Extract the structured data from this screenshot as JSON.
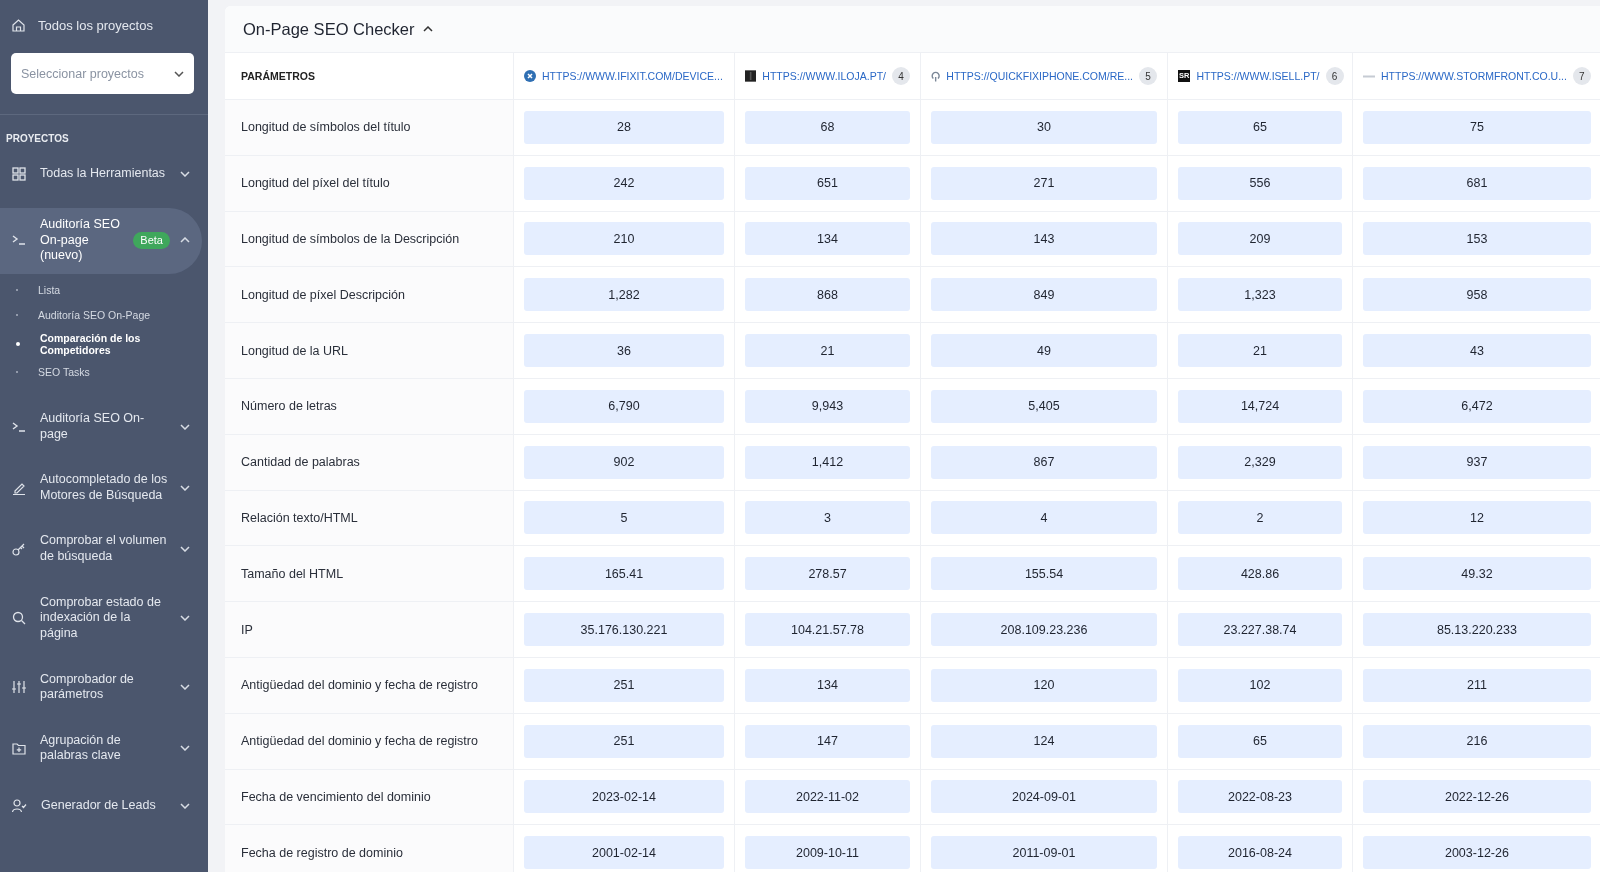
{
  "sidebar": {
    "home_link": "Todos los proyectos",
    "project_select": {
      "placeholder": "Seleccionar proyectos"
    },
    "section_title": "PROYECTOS",
    "items": [
      {
        "kind": "grid",
        "label": "Todas la Herramientas",
        "expanded": false,
        "selected": false
      },
      {
        "kind": "terminal",
        "label": "Auditoría SEO On-page (nuevo)",
        "badge": "Beta",
        "expanded": true,
        "selected": true,
        "children": [
          {
            "label": "Lista",
            "selected": false
          },
          {
            "label": "Auditoría SEO On-Page",
            "selected": false
          },
          {
            "label": "Comparación de los Competidores",
            "selected": true
          },
          {
            "label": "SEO Tasks",
            "selected": false
          }
        ]
      },
      {
        "kind": "terminal",
        "label": "Auditoría SEO On-page",
        "expanded": false,
        "selected": false
      },
      {
        "kind": "pencil",
        "label": "Autocompletado de los Motores de Búsqueda",
        "expanded": false,
        "selected": false
      },
      {
        "kind": "key",
        "label": "Comprobar el volumen de búsqueda",
        "expanded": false,
        "selected": false
      },
      {
        "kind": "search",
        "label": "Comprobar estado de indexación de la página",
        "expanded": false,
        "selected": false
      },
      {
        "kind": "sliders",
        "label": "Comprobador de parámetros",
        "expanded": false,
        "selected": false
      },
      {
        "kind": "folder",
        "label": "Agrupación de palabras clave",
        "expanded": false,
        "selected": false
      },
      {
        "kind": "user",
        "label": "Generador de Leads",
        "expanded": false,
        "selected": false
      }
    ]
  },
  "panel": {
    "title": "On-Page SEO Checker",
    "expanded": true
  },
  "table": {
    "param_header": "PARÁMETROS",
    "columns": [
      {
        "kind": "x-circle",
        "url": "HTTPS://WWW.IFIXIT.COM/DEVICE..."
      },
      {
        "kind": "dark-square",
        "url": "HTTPS://WWW.ILOJA.PT/",
        "count": "4"
      },
      {
        "kind": "ring",
        "url": "HTTPS://QUICKFIXIPHONE.COM/RE...",
        "count": "5"
      },
      {
        "kind": "text",
        "favicon_text": "SR",
        "url": "HTTPS://WWW.ISELL.PT/",
        "count": "6"
      },
      {
        "kind": "dash",
        "url": "HTTPS://WWW.STORMFRONT.CO.U...",
        "count": "7"
      }
    ],
    "rows": [
      {
        "param": "Longitud de símbolos del título",
        "values": [
          "28",
          "68",
          "30",
          "65",
          "75"
        ]
      },
      {
        "param": "Longitud del píxel del título",
        "values": [
          "242",
          "651",
          "271",
          "556",
          "681"
        ]
      },
      {
        "param": "Longitud de símbolos de la Descripción",
        "values": [
          "210",
          "134",
          "143",
          "209",
          "153"
        ]
      },
      {
        "param": "Longitud de píxel Descripción",
        "values": [
          "1,282",
          "868",
          "849",
          "1,323",
          "958"
        ]
      },
      {
        "param": "Longitud de la URL",
        "values": [
          "36",
          "21",
          "49",
          "21",
          "43"
        ]
      },
      {
        "param": "Número de letras",
        "values": [
          "6,790",
          "9,943",
          "5,405",
          "14,724",
          "6,472"
        ]
      },
      {
        "param": "Cantidad de palabras",
        "values": [
          "902",
          "1,412",
          "867",
          "2,329",
          "937"
        ]
      },
      {
        "param": "Relación texto/HTML",
        "values": [
          "5",
          "3",
          "4",
          "2",
          "12"
        ]
      },
      {
        "param": "Tamaño del HTML",
        "values": [
          "165.41",
          "278.57",
          "155.54",
          "428.86",
          "49.32"
        ]
      },
      {
        "param": "IP",
        "values": [
          "35.176.130.221",
          "104.21.57.78",
          "208.109.23.236",
          "23.227.38.74",
          "85.13.220.233"
        ]
      },
      {
        "param": "Antigüedad del dominio y fecha de registro",
        "values": [
          "251",
          "134",
          "120",
          "102",
          "211"
        ]
      },
      {
        "param": "Antigüedad del dominio y fecha de registro",
        "values": [
          "251",
          "147",
          "124",
          "65",
          "216"
        ]
      },
      {
        "param": "Fecha de vencimiento del dominio",
        "values": [
          "2023-02-14",
          "2022-11-02",
          "2024-09-01",
          "2022-08-23",
          "2022-12-26"
        ]
      },
      {
        "param": "Fecha de registro de dominio",
        "values": [
          "2001-02-14",
          "2009-10-11",
          "2011-09-01",
          "2016-08-24",
          "2003-12-26"
        ]
      }
    ]
  }
}
